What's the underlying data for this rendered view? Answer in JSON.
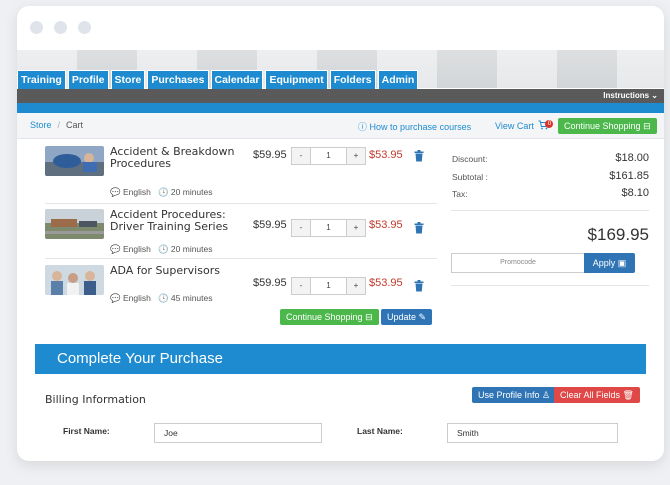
{
  "nav": {
    "tabs": [
      "Training",
      "Profile",
      "Store",
      "Purchases",
      "Calendar",
      "Equipment",
      "Folders",
      "Admin"
    ]
  },
  "instructions_label": "Instructions",
  "breadcrumb": {
    "store": "Store",
    "separator": "/",
    "current": "Cart"
  },
  "toolbar": {
    "how_to": "How to purchase courses",
    "view_cart": "View Cart",
    "cart_count": "0",
    "continue_shopping": "Continue Shopping"
  },
  "cart": {
    "items": [
      {
        "title": "Accident & Breakdown Procedures",
        "language": "English",
        "duration": "20 minutes",
        "price": "$59.95",
        "qty": "1",
        "sale_price": "$53.95"
      },
      {
        "title": "Accident Procedures: Driver Training Series",
        "language": "English",
        "duration": "20 minutes",
        "price": "$59.95",
        "qty": "1",
        "sale_price": "$53.95"
      },
      {
        "title": "ADA for Supervisors",
        "language": "English",
        "duration": "45 minutes",
        "price": "$59.95",
        "qty": "1",
        "sale_price": "$53.95"
      }
    ],
    "qty_minus": "-",
    "qty_plus": "+",
    "continue_shopping": "Continue Shopping",
    "update": "Update"
  },
  "summary": {
    "discount_label": "Discount:",
    "discount": "$18.00",
    "subtotal_label": "Subtotal :",
    "subtotal": "$161.85",
    "tax_label": "Tax:",
    "tax": "$8.10",
    "total": "$169.95",
    "promo_placeholder": "Promocode",
    "apply": "Apply"
  },
  "purchase": {
    "header": "Complete Your Purchase",
    "billing_title": "Billing Information",
    "use_profile": "Use Profile Info",
    "clear_all": "Clear All Fields",
    "first_name_label": "First Name:",
    "first_name": "Joe",
    "last_name_label": "Last Name:",
    "last_name": "Smith"
  },
  "colors": {
    "brand_blue": "#1e8bd0",
    "green": "#4cb84c",
    "dark_blue": "#2f74b5",
    "red": "#e04848",
    "sale_red": "#c0392b"
  }
}
